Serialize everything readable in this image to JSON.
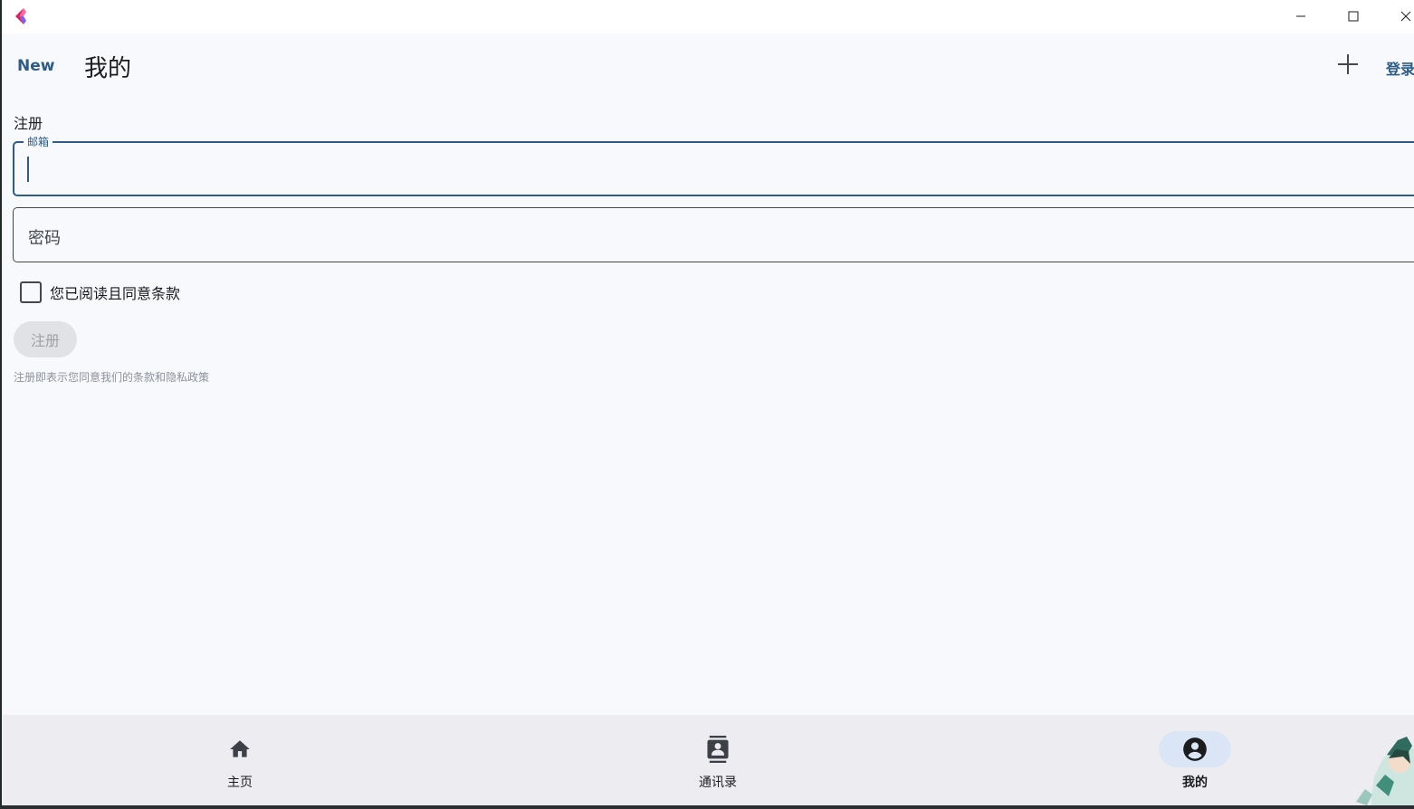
{
  "window": {
    "minimize_icon": "minimize-icon",
    "maximize_icon": "maximize-icon",
    "close_icon": "close-icon"
  },
  "appbar": {
    "new_label": "New",
    "title": "我的",
    "add_icon": "plus-icon",
    "login_label": "登录"
  },
  "form": {
    "section_title": "注册",
    "email_label": "邮箱",
    "email_value": "",
    "password_placeholder": "密码",
    "agree_label": "您已阅读且同意条款",
    "agree_checked": false,
    "register_label": "注册",
    "footnote": "注册即表示您同意我们的条款和隐私政策"
  },
  "nav": {
    "items": [
      {
        "label": "主页",
        "icon": "home-icon",
        "selected": false
      },
      {
        "label": "通讯录",
        "icon": "contacts-icon",
        "selected": false
      },
      {
        "label": "我的",
        "icon": "account-circle-icon",
        "selected": true
      }
    ]
  },
  "colors": {
    "primary": "#2e5c86",
    "background": "#f7f9fd",
    "nav_background": "#ececf1",
    "nav_indicator": "#dae6f6"
  }
}
